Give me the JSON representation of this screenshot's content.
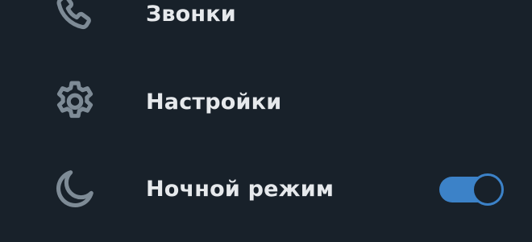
{
  "menu": {
    "items": [
      {
        "label": "Звонки",
        "icon": "phone-icon"
      },
      {
        "label": "Настройки",
        "icon": "gear-icon"
      },
      {
        "label": "Ночной режим",
        "icon": "moon-icon"
      }
    ],
    "night_mode_enabled": true
  },
  "colors": {
    "background": "#18212a",
    "icon": "#7e8b96",
    "text": "#e6e9ec",
    "accent": "#3c82c8"
  }
}
